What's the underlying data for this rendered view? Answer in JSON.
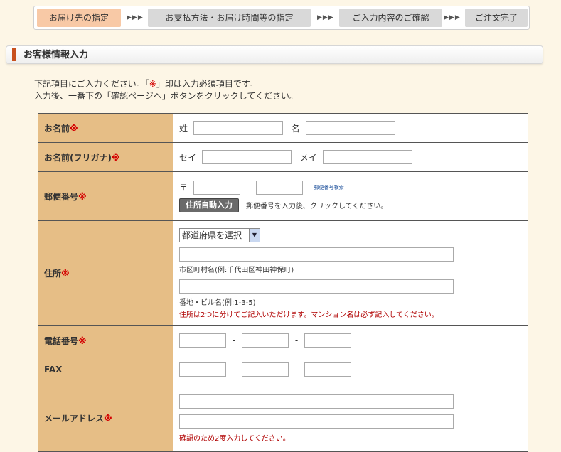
{
  "steps": {
    "items": [
      {
        "label": "お届け先の指定",
        "active": true
      },
      {
        "label": "お支払方法・お届け時間等の指定",
        "active": false
      },
      {
        "label": "ご入力内容のご確認",
        "active": false
      },
      {
        "label": "ご注文完了",
        "active": false
      }
    ],
    "arrow": "▶▶▶"
  },
  "section": {
    "title": "お客様情報入力"
  },
  "intro": {
    "line1_a": "下記項目にご入力ください。「",
    "line1_mark": "※",
    "line1_b": "」印は入力必須項目です。",
    "line2": "入力後、一番下の「確認ページへ」ボタンをクリックしてください。"
  },
  "required_mark": "※",
  "form": {
    "name": {
      "label": "お名前",
      "sei": "姓",
      "mei": "名"
    },
    "kana": {
      "label": "お名前(フリガナ)",
      "sei": "セイ",
      "mei": "メイ"
    },
    "zip": {
      "label": "郵便番号",
      "prefix": "〒",
      "dash": "-",
      "search_link": "郵便番号検索",
      "auto_button": "住所自動入力",
      "hint": "郵便番号を入力後、クリックしてください。"
    },
    "address": {
      "label": "住所",
      "pref_selected": "都道府県を選択",
      "hint1": "市区町村名(例:千代田区神田神保町)",
      "hint2": "番地・ビル名(例:1-3-5)",
      "note": "住所は2つに分けてご記入いただけます。マンション名は必ず記入してください。"
    },
    "tel": {
      "label": "電話番号",
      "dash": "-"
    },
    "fax": {
      "label": "FAX",
      "dash": "-"
    },
    "email": {
      "label": "メールアドレス",
      "note": "確認のため2度入力してください。"
    }
  }
}
